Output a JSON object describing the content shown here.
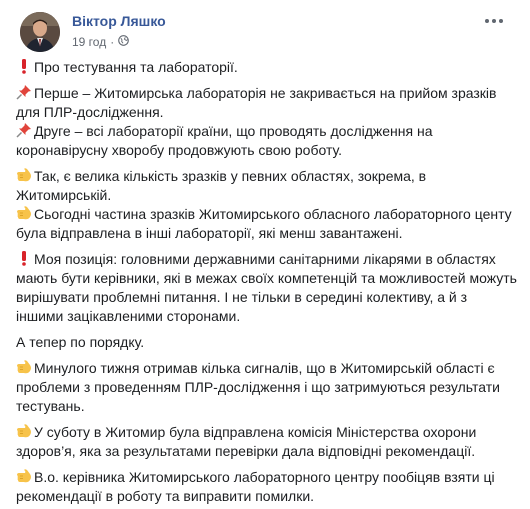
{
  "post": {
    "author": "Віктор Ляшко",
    "timestamp": "19 год",
    "privacy_icon": "globe-icon",
    "more_icon": "more-options-icon",
    "paragraphs": [
      {
        "icon": "exclamation-icon",
        "text": "Про тестування та лабораторії."
      },
      {
        "icon": "pushpin-icon",
        "text": "Перше – Житомирська лабораторія не закривається на прийом зразків для ПЛР-дослідження.",
        "tight": true
      },
      {
        "icon": "pushpin-icon",
        "text": "Друге – всі лабораторії країни, що проводять дослідження на коронавірусну хворобу продовжують свою роботу."
      },
      {
        "icon": "point-right-icon",
        "text": "Так, є велика кількість зразків у певних областях, зокрема, в Житомирській.",
        "tight": true
      },
      {
        "icon": "point-right-icon",
        "text": "Сьогодні частина зразків Житомирського обласного лабораторного центу була відправлена в інші лабораторії, які менш завантажені."
      },
      {
        "icon": "exclamation-icon",
        "text": "Моя позиція: головними державними санітарними лікарями в областях мають бути керівники, які в межах своїх компетенцій та можливостей можуть вирішувати проблемні питання. І не тільки в середині колективу, а й з іншими зацікавленими сторонами."
      },
      {
        "icon": "",
        "text": "А тепер по порядку."
      },
      {
        "icon": "point-right-icon",
        "text": "Минулого тижня отримав кілька сигналів, що в Житомирській області є проблеми з проведенням ПЛР-дослідження і що затримуються результати тестувань."
      },
      {
        "icon": "point-right-icon",
        "text": "У суботу в Житомир була відправлена комісія Міністерства охорони здоров’я, яка за результатами перевірки дала відповідні рекомендації."
      },
      {
        "icon": "point-right-icon",
        "text": "В.о. керівника Житомирського лабораторного центру пообіцяв взяти ці рекомендації в роботу та виправити помилки."
      }
    ]
  }
}
